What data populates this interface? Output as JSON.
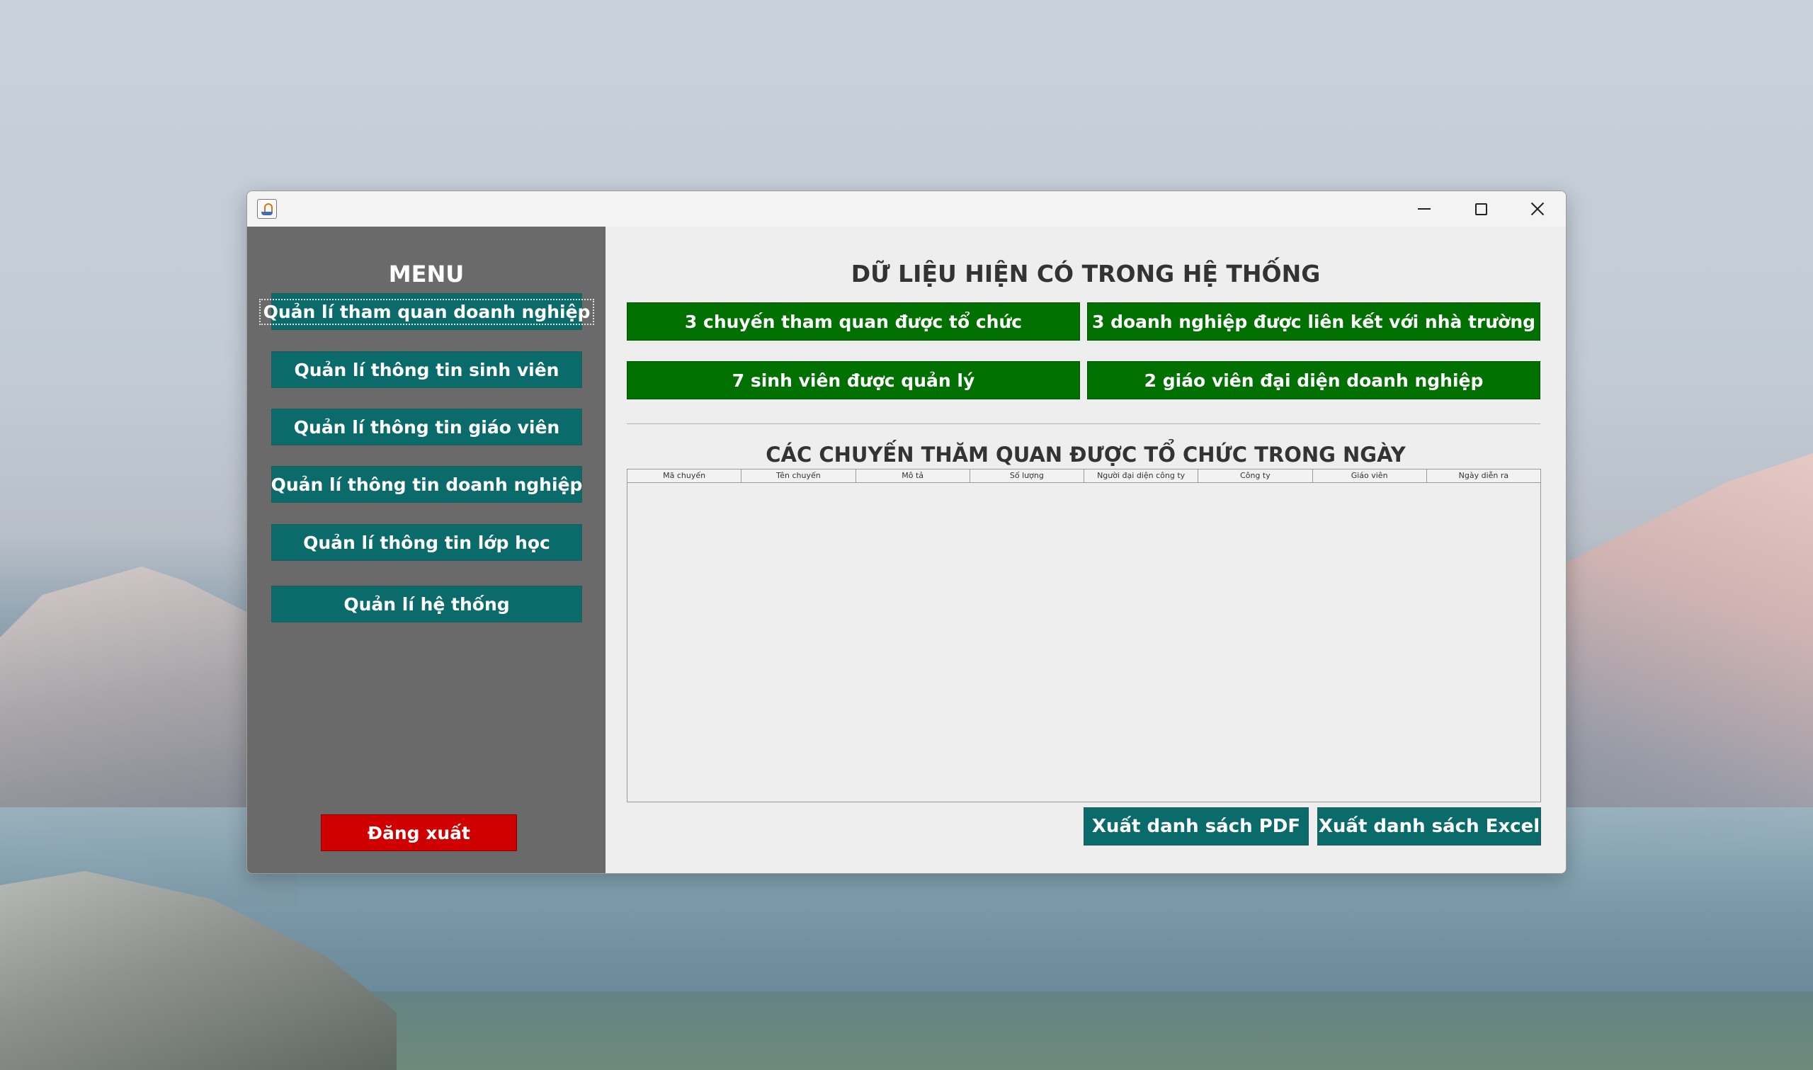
{
  "sidebar": {
    "title": "MENU",
    "items": [
      {
        "label": "Quản lí tham quan doanh nghiệp"
      },
      {
        "label": "Quản lí thông tin sinh viên"
      },
      {
        "label": "Quản lí thông tin giáo viên"
      },
      {
        "label": "Quản lí thông tin doanh nghiệp"
      },
      {
        "label": "Quản lí thông tin lớp học"
      },
      {
        "label": "Quản lí hệ thống"
      }
    ],
    "logout_label": "Đăng xuất"
  },
  "main": {
    "title": "DỮ LIỆU HIỆN CÓ TRONG HỆ THỐNG",
    "stats": [
      {
        "label": "3 chuyến tham quan được tổ chức"
      },
      {
        "label": "3 doanh nghiệp được liên kết với nhà trường"
      },
      {
        "label": "7 sinh viên được quản lý"
      },
      {
        "label": "2 giáo viên đại diện doanh nghiệp"
      }
    ],
    "table_title": "CÁC CHUYẾN THĂM QUAN ĐƯỢC TỔ CHỨC TRONG NGÀY",
    "table_columns": [
      "Mã chuyến",
      "Tên chuyến",
      "Mô tả",
      "Số lượng",
      "Người đại diện công ty",
      "Công ty",
      "Giáo viên",
      "Ngày diễn ra"
    ],
    "export_pdf_label": "Xuất danh sách PDF",
    "export_excel_label": "Xuất danh sách Excel"
  },
  "colors": {
    "sidebar_bg": "#6a6a6a",
    "menu_button": "#0b6b6b",
    "stat_button": "#007000",
    "logout_button": "#d00000"
  },
  "icons": {
    "app": "java-app-icon",
    "minimize": "minimize-icon",
    "maximize": "maximize-icon",
    "close": "close-icon"
  }
}
